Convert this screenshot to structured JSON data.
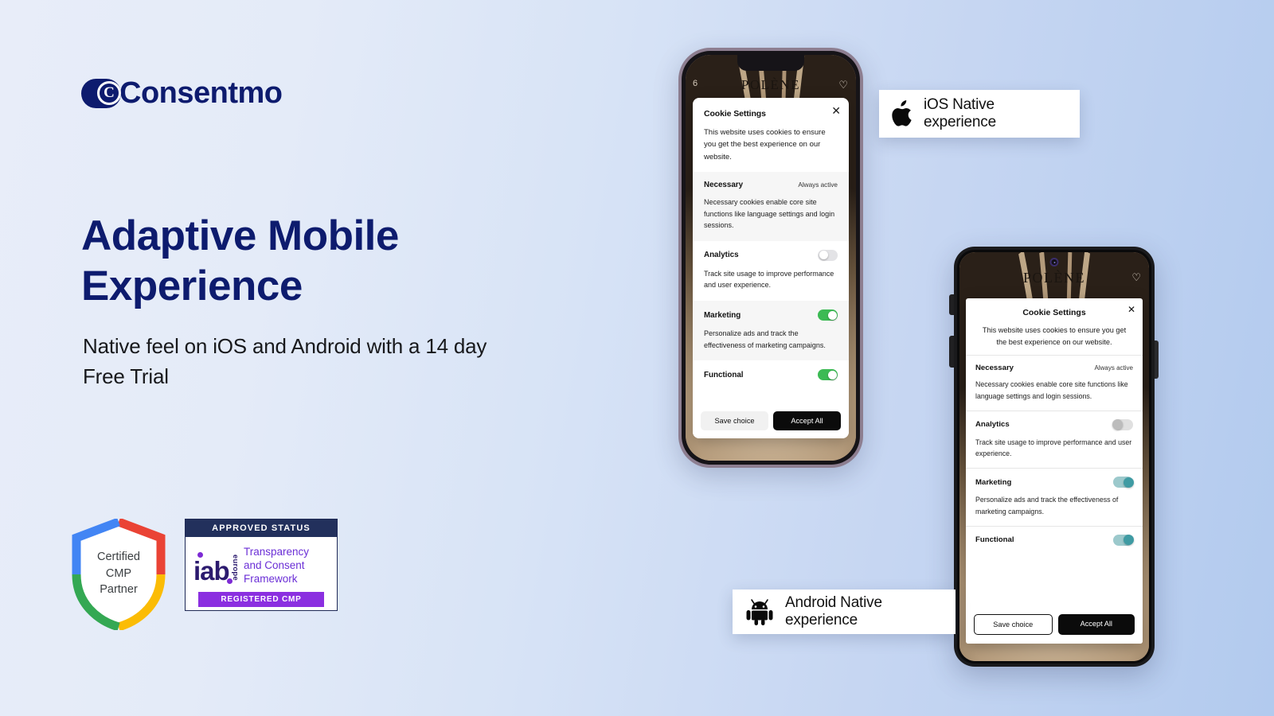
{
  "brand": {
    "name": "Consentmo",
    "logo_icon": "consentmo-copyright-icon",
    "navy": "#0d1b6e"
  },
  "hero": {
    "headline": "Adaptive Mobile Experience",
    "subheadline": "Native feel on iOS and Android with a 14 day Free Trial"
  },
  "badges": {
    "certified": {
      "line1": "Certified",
      "line2": "CMP",
      "line3": "Partner",
      "colors": [
        "#4285f4",
        "#ea4335",
        "#fbbc05",
        "#34a853"
      ]
    },
    "iab": {
      "top_label": "APPROVED STATUS",
      "logo_text": "iab",
      "logo_sub": "europe",
      "framework_line1": "Transparency",
      "framework_line2": "and Consent",
      "framework_line3": "Framework",
      "bottom_label": "REGISTERED CMP",
      "purple": "#8b2fe0"
    }
  },
  "labels": {
    "ios": {
      "text": "iOS Native experience",
      "icon": "apple-icon"
    },
    "android": {
      "text": "Android Native experience",
      "icon": "android-robot-icon"
    }
  },
  "ios_banner": {
    "site_name": "POLÈNE",
    "site_badge": "6",
    "title": "Cookie Settings",
    "description": "This website uses cookies to ensure you get the best experience on our website.",
    "close_icon": "close-icon",
    "toggle_on_color": "#3cba54",
    "categories": [
      {
        "name": "Necessary",
        "status": "Always active",
        "description": "Necessary cookies enable core site functions like language settings and login sessions.",
        "toggle": "always"
      },
      {
        "name": "Analytics",
        "status": "",
        "description": "Track site usage to improve performance and user experience.",
        "toggle": "off"
      },
      {
        "name": "Marketing",
        "status": "",
        "description": "Personalize ads and track the effectiveness of marketing campaigns.",
        "toggle": "on"
      },
      {
        "name": "Functional",
        "status": "",
        "description": "",
        "toggle": "on"
      }
    ],
    "save_button": "Save choice",
    "accept_button": "Accept All"
  },
  "android_banner": {
    "site_name": "POLÈNE",
    "title": "Cookie Settings",
    "description": "This website uses cookies to ensure you get the best experience on our website.",
    "close_icon": "close-icon",
    "toggle_on_color": "#3f9ba3",
    "categories": [
      {
        "name": "Necessary",
        "status": "Always active",
        "description": "Necessary cookies enable core site functions like language settings and login sessions.",
        "toggle": "always"
      },
      {
        "name": "Analytics",
        "status": "",
        "description": "Track site usage to improve performance and user experience.",
        "toggle": "off"
      },
      {
        "name": "Marketing",
        "status": "",
        "description": "Personalize ads and track the effectiveness of marketing campaigns.",
        "toggle": "on"
      },
      {
        "name": "Functional",
        "status": "",
        "description": "",
        "toggle": "on"
      }
    ],
    "save_button": "Save choice",
    "accept_button": "Accept All"
  },
  "background": {
    "gradient_from": "#e8edf9",
    "gradient_to": "#b2caee"
  }
}
